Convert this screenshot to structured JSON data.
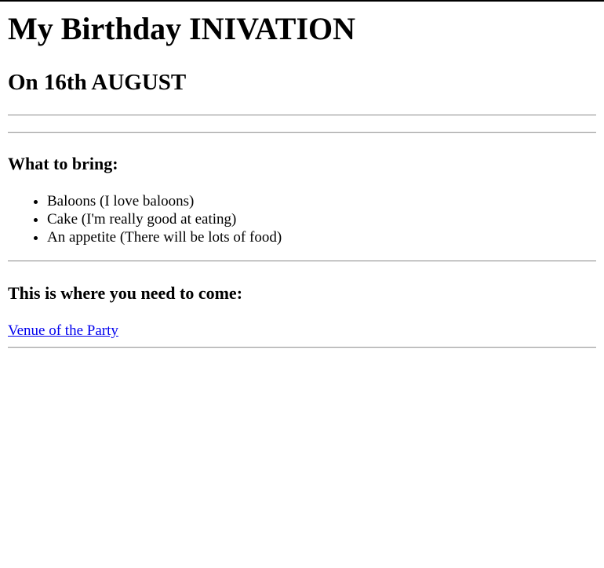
{
  "invitation": {
    "title": "My Birthday INIVATION",
    "date": "On 16th AUGUST"
  },
  "bring_section": {
    "heading": "What to bring:",
    "items": [
      "Baloons (I love baloons)",
      "Cake (I'm really good at eating)",
      "An appetite (There will be lots of food)"
    ]
  },
  "location_section": {
    "heading": "This is where you need to come:",
    "link_text": "Venue of the Party"
  },
  "colors": {
    "link": "#0000ee",
    "rule": "#9a9a9a",
    "text": "#000000"
  }
}
